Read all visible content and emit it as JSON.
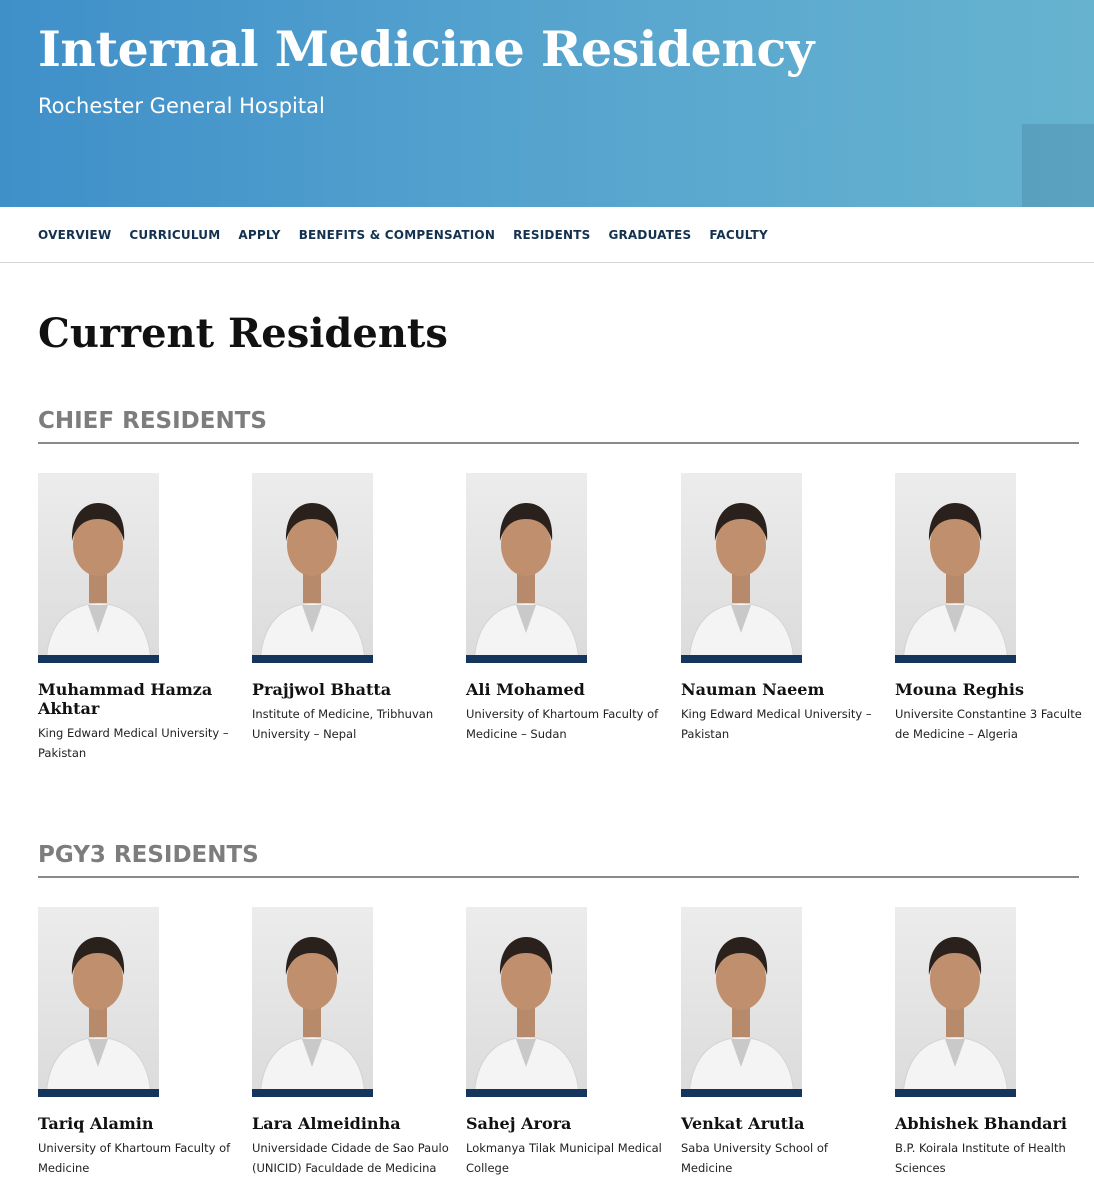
{
  "header": {
    "title": "Internal Medicine Residency",
    "subtitle": "Rochester General Hospital"
  },
  "nav": {
    "items": [
      "OVERVIEW",
      "CURRICULUM",
      "APPLY",
      "BENEFITS & COMPENSATION",
      "RESIDENTS",
      "GRADUATES",
      "FACULTY"
    ]
  },
  "page": {
    "title": "Current Residents"
  },
  "sections": [
    {
      "heading": "CHIEF RESIDENTS",
      "residents": [
        {
          "name": "Muhammad Hamza Akhtar",
          "school": "King Edward Medical University – Pakistan"
        },
        {
          "name": "Prajjwol Bhatta",
          "school": "Institute of Medicine, Tribhuvan University – Nepal"
        },
        {
          "name": "Ali Mohamed",
          "school": "University of Khartoum Faculty of Medicine – Sudan"
        },
        {
          "name": "Nauman Naeem",
          "school": "King Edward Medical University – Pakistan"
        },
        {
          "name": "Mouna Reghis",
          "school": "Universite Constantine 3 Faculte de Medicine – Algeria"
        }
      ]
    },
    {
      "heading": "PGY3 RESIDENTS",
      "residents": [
        {
          "name": "Tariq Alamin",
          "school": "University of Khartoum Faculty of Medicine"
        },
        {
          "name": "Lara Almeidinha",
          "school": "Universidade Cidade de Sao Paulo (UNICID) Faculdade de Medicina"
        },
        {
          "name": "Sahej Arora",
          "school": "Lokmanya Tilak Municipal Medical College"
        },
        {
          "name": "Venkat Arutla",
          "school": "Saba University School of Medicine"
        },
        {
          "name": "Abhishek Bhandari",
          "school": "B.P. Koirala Institute of Health Sciences"
        }
      ]
    }
  ],
  "colors": {
    "header_gradient_start": "#3f8fc9",
    "header_gradient_end": "#66b3cf",
    "nav_text": "#14324f",
    "photo_bar": "#16355c",
    "section_heading": "#7d7d7d"
  }
}
